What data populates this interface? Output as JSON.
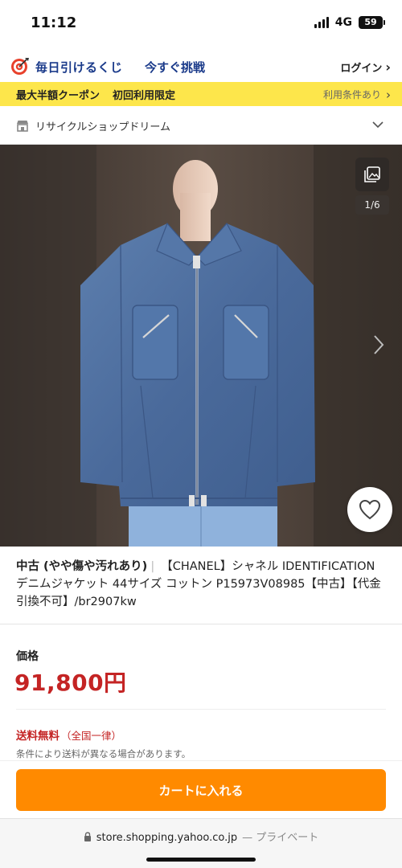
{
  "status_bar": {
    "time": "11:12",
    "network": "4G",
    "battery": "59"
  },
  "lottery_banner": {
    "title": "毎日引けるくじ",
    "cta": "今すぐ挑戦",
    "login": "ログイン"
  },
  "coupon_bar": {
    "title": "最大半額クーポン",
    "subtitle": "初回利用限定",
    "terms": "利用条件あり"
  },
  "store": {
    "name": "リサイクルショップドリーム"
  },
  "image": {
    "counter": "1/6"
  },
  "product": {
    "condition": "中古 (やや傷や汚れあり)",
    "title": "【CHANEL】シャネル IDENTIFICATION デニムジャケット 44サイズ コットン P15973V08985【中古】【代金引換不可】/br2907kw"
  },
  "price": {
    "label": "価格",
    "value": "91,800円"
  },
  "shipping": {
    "free": "送料無料",
    "free_note": "（全国一律）",
    "note": "条件により送料が異なる場合があります。"
  },
  "cart": {
    "button": "カートに入れる"
  },
  "browser": {
    "url": "store.shopping.yahoo.co.jp",
    "private": "— プライベート"
  },
  "colors": {
    "accent_orange": "#ff8a00",
    "price_red": "#c42424",
    "coupon_yellow": "#fde64b",
    "brand_navy": "#1a3a8a"
  }
}
